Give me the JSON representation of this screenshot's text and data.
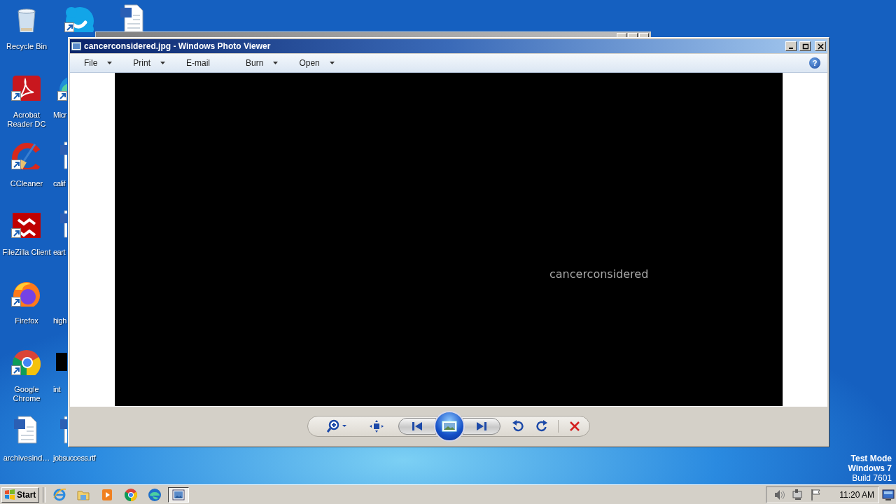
{
  "desktop": {
    "icon_columns": [
      [
        {
          "label": "Recycle Bin",
          "kind": "recycle",
          "shortcut": false,
          "partly_hidden": false
        },
        {
          "label": "Acrobat Reader DC",
          "kind": "pdf",
          "shortcut": true,
          "partly_hidden": false
        },
        {
          "label": "CCleaner",
          "kind": "ccleaner",
          "shortcut": true,
          "partly_hidden": false
        },
        {
          "label": "FileZilla Client",
          "kind": "filezilla",
          "shortcut": true,
          "partly_hidden": false
        },
        {
          "label": "Firefox",
          "kind": "firefox",
          "shortcut": true,
          "partly_hidden": false
        },
        {
          "label": "Google Chrome",
          "kind": "chrome",
          "shortcut": true,
          "partly_hidden": false
        },
        {
          "label": "archivesind…",
          "kind": "word",
          "shortcut": false,
          "partly_hidden": false
        }
      ],
      [
        {
          "kind": "skype",
          "shortcut": true,
          "partly_hidden": false
        },
        {
          "label": "Micr",
          "kind": "edge",
          "shortcut": true,
          "partly_hidden": true
        },
        {
          "label": "calif",
          "kind": "word",
          "shortcut": false,
          "partly_hidden": true
        },
        {
          "label": "eart",
          "kind": "word",
          "shortcut": false,
          "partly_hidden": true
        },
        {
          "label": "high",
          "kind": "blank",
          "shortcut": false,
          "partly_hidden": true
        },
        {
          "label": "int",
          "kind": "black",
          "shortcut": false,
          "partly_hidden": true
        },
        {
          "label": "jobsuccess.rtf",
          "kind": "word",
          "shortcut": false,
          "partly_hidden": true
        }
      ],
      [
        {
          "kind": "word",
          "shortcut": false,
          "partly_hidden": false
        }
      ]
    ],
    "system_text": [
      "Test Mode",
      "Windows 7",
      "Build 7601"
    ]
  },
  "photo_viewer": {
    "title": "cancerconsidered.jpg - Windows Photo Viewer",
    "menu": [
      {
        "label": "File",
        "dropdown": true
      },
      {
        "label": "Print",
        "dropdown": true
      },
      {
        "label": "E-mail",
        "dropdown": false
      },
      {
        "label": "Burn",
        "dropdown": true
      },
      {
        "label": "Open",
        "dropdown": true
      }
    ],
    "help": "?",
    "image": {
      "caption": "cancerconsidered"
    },
    "controls": [
      {
        "kind": "zoom"
      },
      {
        "kind": "actual_size"
      },
      {
        "kind": "previous"
      },
      {
        "kind": "slideshow"
      },
      {
        "kind": "next"
      },
      {
        "kind": "rotate_left"
      },
      {
        "kind": "rotate_right"
      },
      {
        "kind": "delete"
      }
    ]
  },
  "taskbar": {
    "start": "Start",
    "apps": [
      {
        "kind": "ie",
        "selected": false
      },
      {
        "kind": "explorer",
        "selected": false
      },
      {
        "kind": "media",
        "selected": false
      },
      {
        "kind": "chrome",
        "selected": false
      },
      {
        "kind": "edge",
        "selected": false
      },
      {
        "kind": "photo_viewer",
        "selected": true
      }
    ],
    "tray": [
      {
        "kind": "volume"
      },
      {
        "kind": "network"
      },
      {
        "kind": "flag"
      }
    ],
    "clock": "11:20 AM"
  }
}
